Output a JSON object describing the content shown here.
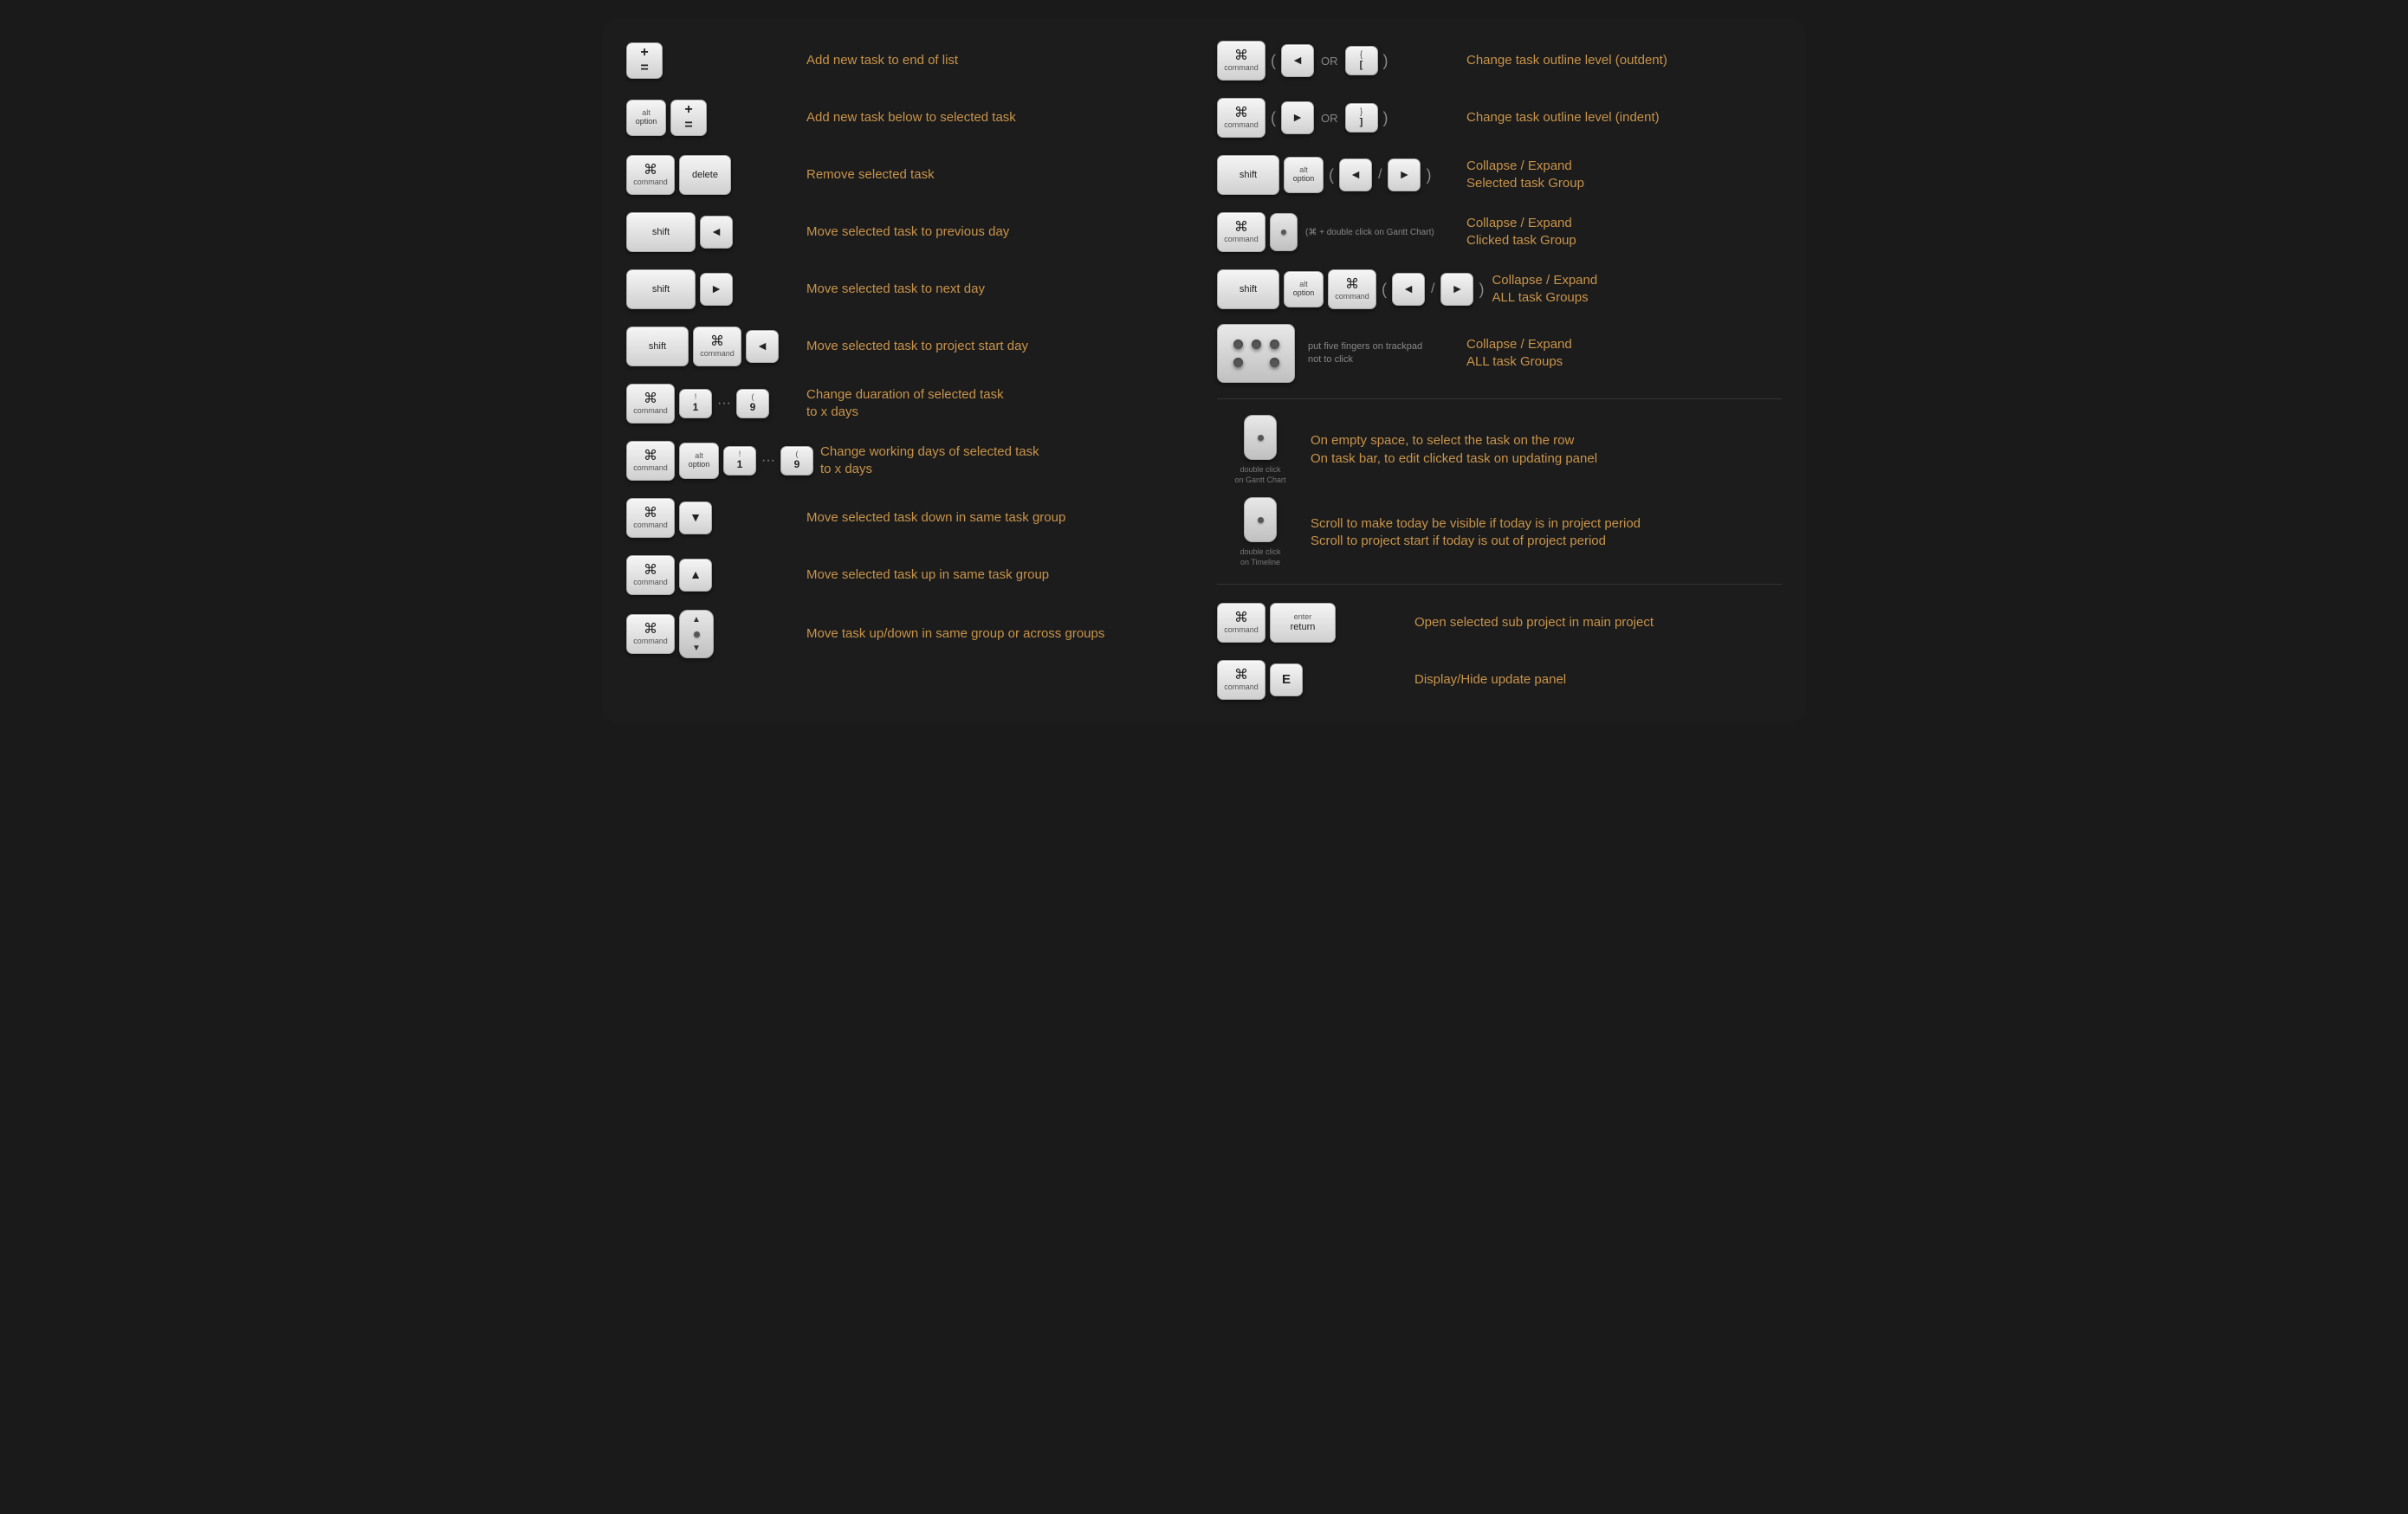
{
  "left": {
    "rows": [
      {
        "id": "add-end",
        "keys": [
          {
            "label": "+\n=",
            "size": "small plus-equal",
            "type": "single"
          }
        ],
        "desc": "Add new task to end of list"
      },
      {
        "id": "add-below",
        "keys": [
          {
            "top": "alt",
            "bottom": "option",
            "size": "xsmall",
            "type": "stacked"
          },
          {
            "label": "+\n=",
            "size": "small plus-equal",
            "type": "single"
          }
        ],
        "desc": "Add new task below to selected task"
      },
      {
        "id": "remove",
        "keys": [
          {
            "symbol": "⌘",
            "bottom": "command",
            "size": "medium cmd",
            "type": "cmd"
          },
          {
            "label": "delete",
            "size": "medium",
            "type": "text"
          }
        ],
        "desc": "Remove selected task"
      },
      {
        "id": "prev-day",
        "keys": [
          {
            "label": "shift",
            "size": "wide",
            "type": "text"
          },
          {
            "label": "◄",
            "size": "small",
            "type": "arrow"
          }
        ],
        "desc": "Move selected task to previous day"
      },
      {
        "id": "next-day",
        "keys": [
          {
            "label": "shift",
            "size": "wide",
            "type": "text"
          },
          {
            "label": "►",
            "size": "small",
            "type": "arrow"
          }
        ],
        "desc": "Move selected task to next day"
      },
      {
        "id": "start-day",
        "keys": [
          {
            "label": "shift",
            "size": "wide",
            "type": "text"
          },
          {
            "symbol": "⌘",
            "bottom": "command",
            "size": "medium cmd",
            "type": "cmd"
          },
          {
            "label": "◄",
            "size": "small",
            "type": "arrow"
          }
        ],
        "desc": "Move selected task to project start day"
      },
      {
        "id": "duration",
        "keys": [
          {
            "symbol": "⌘",
            "bottom": "command",
            "size": "medium cmd",
            "type": "cmd"
          },
          {
            "top": "!",
            "bottom": "1",
            "size": "small",
            "type": "numkey"
          },
          {
            "dots": true
          },
          {
            "top": "(",
            "bottom": "9",
            "size": "small",
            "type": "numkey"
          }
        ],
        "desc": "Change duaration of selected task\nto x days"
      },
      {
        "id": "working-days",
        "keys": [
          {
            "symbol": "⌘",
            "bottom": "command",
            "size": "medium cmd",
            "type": "cmd"
          },
          {
            "top": "alt",
            "bottom": "option",
            "size": "xsmall",
            "type": "stacked"
          },
          {
            "top": "!",
            "bottom": "1",
            "size": "small",
            "type": "numkey"
          },
          {
            "dots": true
          },
          {
            "top": "(",
            "bottom": "9",
            "size": "small",
            "type": "numkey"
          }
        ],
        "desc": "Change working days of selected task\nto x days"
      },
      {
        "id": "move-down",
        "keys": [
          {
            "symbol": "⌘",
            "bottom": "command",
            "size": "medium cmd",
            "type": "cmd"
          },
          {
            "label": "▼",
            "size": "small",
            "type": "arrow"
          }
        ],
        "desc": "Move selected task down in same task group"
      },
      {
        "id": "move-up",
        "keys": [
          {
            "symbol": "⌘",
            "bottom": "command",
            "size": "medium cmd",
            "type": "cmd"
          },
          {
            "label": "▲",
            "size": "small",
            "type": "arrow"
          }
        ],
        "desc": "Move selected task up in same task group"
      },
      {
        "id": "move-updown",
        "keys": [
          {
            "symbol": "⌘",
            "bottom": "command",
            "size": "medium cmd",
            "type": "cmd"
          },
          {
            "type": "mouse-arrow"
          }
        ],
        "desc": "Move task up/down in same group or across groups"
      }
    ]
  },
  "right": {
    "rows": [
      {
        "id": "outdent",
        "keys": [
          {
            "symbol": "⌘",
            "bottom": "command",
            "size": "medium cmd",
            "type": "cmd"
          },
          {
            "paren": "("
          },
          {
            "label": "◄",
            "size": "small",
            "type": "arrow"
          },
          {
            "or": "OR"
          },
          {
            "top": "{",
            "bottom": "[",
            "size": "small",
            "type": "numkey"
          },
          {
            "paren": ")"
          }
        ],
        "desc": "Change task outline level (outdent)"
      },
      {
        "id": "indent",
        "keys": [
          {
            "symbol": "⌘",
            "bottom": "command",
            "size": "medium cmd",
            "type": "cmd"
          },
          {
            "paren": "("
          },
          {
            "label": "►",
            "size": "small",
            "type": "arrow"
          },
          {
            "or": "OR"
          },
          {
            "top": "}",
            "bottom": "]",
            "size": "small",
            "type": "numkey"
          },
          {
            "paren": ")"
          }
        ],
        "desc": "Change task outline level (indent)"
      },
      {
        "id": "collapse-expand-selected",
        "keys": [
          {
            "label": "shift",
            "size": "wide",
            "type": "text"
          },
          {
            "top": "alt",
            "bottom": "option",
            "size": "xsmall",
            "type": "stacked"
          },
          {
            "paren": "("
          },
          {
            "label": "◄",
            "size": "small",
            "type": "arrow"
          },
          {
            "slash": "/"
          },
          {
            "label": "►",
            "size": "small",
            "type": "arrow"
          },
          {
            "paren": ")"
          }
        ],
        "desc": "Collapse / Expand\nSelected task Group"
      },
      {
        "id": "collapse-expand-clicked",
        "keys": [
          {
            "symbol": "⌘",
            "bottom": "command",
            "size": "medium cmd",
            "type": "cmd"
          },
          {
            "type": "mouse-dot"
          },
          {
            "text": "(⌘ + double click on Gantt Chart)"
          }
        ],
        "desc": "Collapse / Expand\nClicked task Group"
      },
      {
        "id": "collapse-expand-all",
        "keys": [
          {
            "label": "shift",
            "size": "wide",
            "type": "text"
          },
          {
            "top": "alt",
            "bottom": "option",
            "size": "xsmall",
            "type": "stacked"
          },
          {
            "symbol": "⌘",
            "bottom": "command",
            "size": "medium cmd",
            "type": "cmd"
          },
          {
            "paren": "("
          },
          {
            "label": "◄",
            "size": "small",
            "type": "arrow"
          },
          {
            "slash": "/"
          },
          {
            "label": "►",
            "size": "small",
            "type": "arrow"
          },
          {
            "paren": ")"
          }
        ],
        "desc": "Collapse / Expand\nALL task Groups"
      },
      {
        "id": "trackpad-collapse",
        "type": "trackpad",
        "desc": "Collapse / Expand\nALL task Groups",
        "subdesc": "put five fingers on trackpad\nnot to click"
      },
      {
        "id": "dbl-gantt",
        "type": "mouse-dbl",
        "label": "double click\non Gantt Chart",
        "desc": "On empty space, to select the task on the row\nOn task bar, to edit clicked task on updating panel"
      },
      {
        "id": "dbl-timeline",
        "type": "mouse-dbl",
        "label": "double click\non Timeline",
        "desc": "Scroll to make today be visible if today is in project period\nScroll to project start if today is out of project period"
      },
      {
        "id": "open-subproject",
        "keys": [
          {
            "symbol": "⌘",
            "bottom": "command",
            "size": "medium cmd",
            "type": "cmd"
          },
          {
            "top": "enter",
            "bottom": "return",
            "size": "wide",
            "type": "text2"
          }
        ],
        "desc": "Open selected sub project in main project"
      },
      {
        "id": "display-panel",
        "keys": [
          {
            "symbol": "⌘",
            "bottom": "command",
            "size": "medium cmd",
            "type": "cmd"
          },
          {
            "label": "E",
            "size": "small",
            "type": "letter"
          }
        ],
        "desc": "Display/Hide update panel"
      }
    ]
  }
}
